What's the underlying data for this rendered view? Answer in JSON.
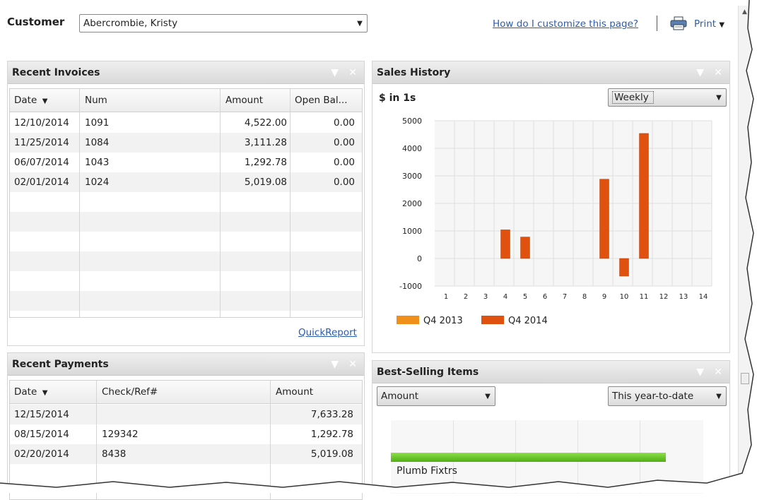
{
  "header": {
    "customer_label": "Customer",
    "customer_value": "Abercrombie, Kristy",
    "customize_link": "How do I customize this page?",
    "print_label": "Print"
  },
  "recent_invoices": {
    "title": "Recent Invoices",
    "columns": [
      "Date",
      "Num",
      "Amount",
      "Open Bal..."
    ],
    "rows": [
      [
        "12/10/2014",
        "1091",
        "4,522.00",
        "0.00"
      ],
      [
        "11/25/2014",
        "1084",
        "3,111.28",
        "0.00"
      ],
      [
        "06/07/2014",
        "1043",
        "1,292.78",
        "0.00"
      ],
      [
        "02/01/2014",
        "1024",
        "5,019.08",
        "0.00"
      ]
    ],
    "quickreport_link": "QuickReport"
  },
  "recent_payments": {
    "title": "Recent Payments",
    "columns": [
      "Date",
      "Check/Ref#",
      "Amount"
    ],
    "rows": [
      [
        "12/15/2014",
        "",
        "7,633.28"
      ],
      [
        "08/15/2014",
        "129342",
        "1,292.78"
      ],
      [
        "02/20/2014",
        "8438",
        "5,019.08"
      ]
    ]
  },
  "sales_history": {
    "title": "Sales History",
    "units_label": "$ in 1s",
    "period_select": "Weekly"
  },
  "best_selling": {
    "title": "Best-Selling Items",
    "metric_select": "Amount",
    "range_select": "This year-to-date",
    "item_label": "Plumb Fixtrs",
    "bar_fraction": 0.88
  },
  "colors": {
    "accent_link": "#2a5db0",
    "q4_2013": "#f0901a",
    "q4_2014": "#e0500f",
    "best_bar": "#63c41d"
  },
  "chart_data": {
    "type": "bar",
    "ylim": [
      -1000,
      5000
    ],
    "yticks": [
      "5000",
      "4000",
      "3000",
      "2000",
      "1000",
      "0",
      "-1000"
    ],
    "categories": [
      "1",
      "2",
      "3",
      "4",
      "5",
      "6",
      "7",
      "8",
      "9",
      "10",
      "11",
      "12",
      "13",
      "14"
    ],
    "series": [
      {
        "name": "Q4 2013",
        "values": [
          0,
          0,
          0,
          0,
          0,
          0,
          0,
          0,
          0,
          0,
          0,
          0,
          0,
          0
        ]
      },
      {
        "name": "Q4 2014",
        "values": [
          0,
          0,
          0,
          1040,
          780,
          0,
          0,
          0,
          2880,
          -640,
          4540,
          0,
          0,
          0
        ]
      }
    ],
    "grid": true,
    "legend": "bottom-left"
  }
}
